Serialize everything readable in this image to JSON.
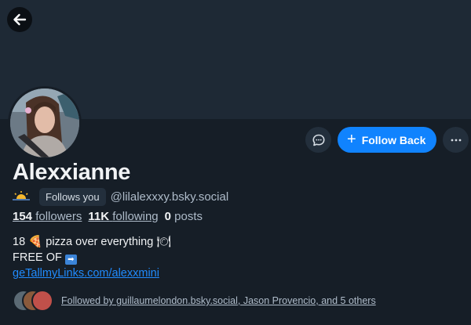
{
  "profile": {
    "display_name": "Alexxianne",
    "handle": "@lilalexxxy.bsky.social",
    "follows_you_label": "Follows you",
    "status_emoji": "☀",
    "follow_back_label": "Follow Back",
    "stats": {
      "followers_count": "154",
      "followers_label": "followers",
      "following_count": "11K",
      "following_label": "following",
      "posts_count": "0",
      "posts_label": "posts"
    },
    "bio": {
      "line1_pre": "18",
      "line1_text": "pizza over everything",
      "line2_text": "FREE OF",
      "link": "geTallmyLinks.com/alexxmini"
    },
    "followed_by_text": "Followed by guillaumelondon.bsky.social, Jason Provencio, and 5 others"
  },
  "icons": {
    "back": "arrow-left-icon",
    "message": "chat-bubble-icon",
    "more": "ellipsis-icon",
    "plus": "plus-icon"
  },
  "colors": {
    "accent": "#1083fe",
    "background": "#161e27",
    "banner": "#1e2935"
  }
}
